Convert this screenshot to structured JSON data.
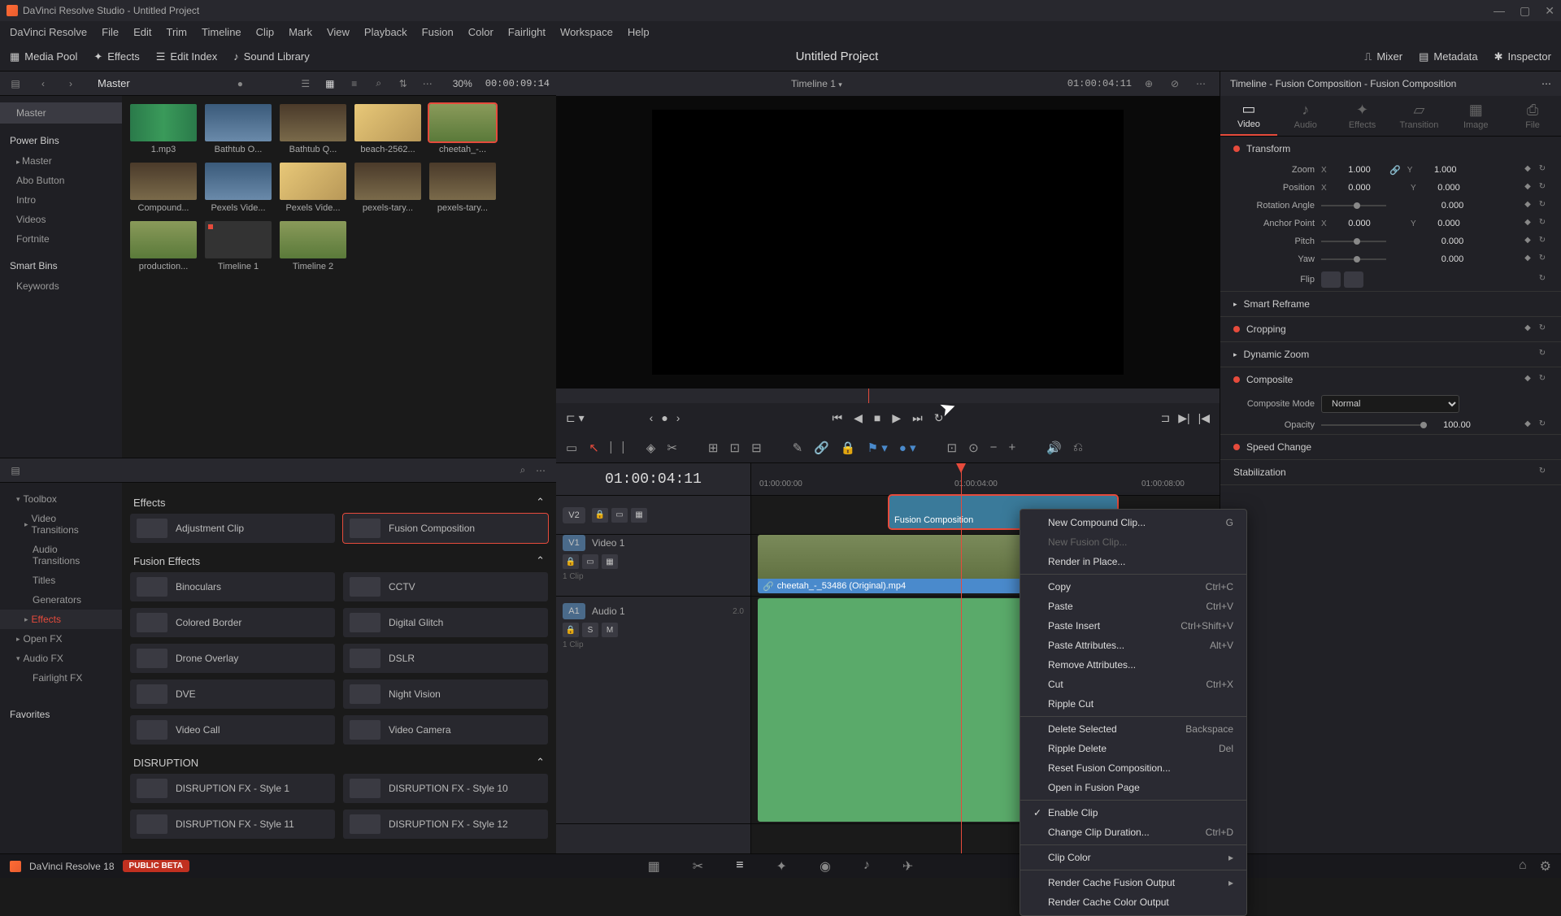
{
  "window": {
    "title": "DaVinci Resolve Studio - Untitled Project"
  },
  "menu": [
    "DaVinci Resolve",
    "File",
    "Edit",
    "Trim",
    "Timeline",
    "Clip",
    "Mark",
    "View",
    "Playback",
    "Fusion",
    "Color",
    "Fairlight",
    "Workspace",
    "Help"
  ],
  "toolbar": {
    "media_pool": "Media Pool",
    "effects": "Effects",
    "edit_index": "Edit Index",
    "sound_library": "Sound Library",
    "mixer": "Mixer",
    "metadata": "Metadata",
    "inspector": "Inspector",
    "project_title": "Untitled Project"
  },
  "media": {
    "master": "Master",
    "zoom": "30%",
    "tc": "00:00:09:14",
    "timeline_name": "Timeline 1",
    "playhead_tc": "01:00:04:11",
    "bins": {
      "section1": "Master",
      "section2": "Power Bins",
      "items2": [
        "Master",
        "Abo Button",
        "Intro",
        "Videos",
        "Fortnite"
      ],
      "section3": "Smart Bins",
      "items3": [
        "Keywords"
      ]
    },
    "clips": [
      "1.mp3",
      "Bathtub O...",
      "Bathtub Q...",
      "beach-2562...",
      "cheetah_-...",
      "Compound...",
      "Pexels Vide...",
      "Pexels Vide...",
      "pexels-tary...",
      "pexels-tary...",
      "production...",
      "Timeline 1",
      "Timeline 2"
    ]
  },
  "effects": {
    "sidebar": {
      "toolbox": "Toolbox",
      "items1": [
        "Video Transitions",
        "Audio Transitions",
        "Titles",
        "Generators",
        "Effects"
      ],
      "openfx": "Open FX",
      "audiofx": "Audio FX",
      "fairlight": "Fairlight FX",
      "favorites": "Favorites"
    },
    "groups": {
      "effects_label": "Effects",
      "fusion_label": "Fusion Effects",
      "disruption_label": "DISRUPTION"
    },
    "items": {
      "adjustment": "Adjustment Clip",
      "fusion_comp": "Fusion Composition",
      "binoculars": "Binoculars",
      "cctv": "CCTV",
      "colored_border": "Colored Border",
      "digital_glitch": "Digital Glitch",
      "drone": "Drone Overlay",
      "dslr": "DSLR",
      "dve": "DVE",
      "night": "Night Vision",
      "video_call": "Video Call",
      "video_camera": "Video Camera",
      "d1": "DISRUPTION FX - Style 1",
      "d10": "DISRUPTION FX - Style 10",
      "d11": "DISRUPTION FX - Style 11",
      "d12": "DISRUPTION FX - Style 12"
    }
  },
  "timeline": {
    "tc": "01:00:04:11",
    "ruler": [
      "01:00:00:00",
      "01:00:04:00",
      "01:00:08:00"
    ],
    "tracks": {
      "v2": "V2",
      "v1": "V1",
      "video1": "Video 1",
      "a1": "A1",
      "audio1": "Audio 1",
      "clip_count": "1 Clip",
      "audio_ch": "2.0"
    },
    "clips": {
      "fusion": "Fusion Composition",
      "video_name": "cheetah_-_53486 (Original).mp4"
    }
  },
  "context_menu": [
    {
      "label": "New Compound Clip...",
      "shortcut": "G"
    },
    {
      "label": "New Fusion Clip...",
      "disabled": true
    },
    {
      "label": "Render in Place..."
    },
    {
      "sep": true
    },
    {
      "label": "Copy",
      "shortcut": "Ctrl+C"
    },
    {
      "label": "Paste",
      "shortcut": "Ctrl+V"
    },
    {
      "label": "Paste Insert",
      "shortcut": "Ctrl+Shift+V"
    },
    {
      "label": "Paste Attributes...",
      "shortcut": "Alt+V"
    },
    {
      "label": "Remove Attributes..."
    },
    {
      "label": "Cut",
      "shortcut": "Ctrl+X"
    },
    {
      "label": "Ripple Cut"
    },
    {
      "sep": true
    },
    {
      "label": "Delete Selected",
      "shortcut": "Backspace"
    },
    {
      "label": "Ripple Delete",
      "shortcut": "Del"
    },
    {
      "label": "Reset Fusion Composition..."
    },
    {
      "label": "Open in Fusion Page"
    },
    {
      "sep": true
    },
    {
      "label": "Enable Clip",
      "checked": true
    },
    {
      "label": "Change Clip Duration...",
      "shortcut": "Ctrl+D"
    },
    {
      "sep": true
    },
    {
      "label": "Clip Color",
      "submenu": true
    },
    {
      "sep": true
    },
    {
      "label": "Render Cache Fusion Output",
      "submenu": true
    },
    {
      "label": "Render Cache Color Output"
    }
  ],
  "inspector": {
    "header": "Timeline - Fusion Composition - Fusion Composition",
    "tabs": [
      "Video",
      "Audio",
      "Effects",
      "Transition",
      "Image",
      "File"
    ],
    "transform": {
      "label": "Transform",
      "zoom": "Zoom",
      "zoom_x": "1.000",
      "zoom_y": "1.000",
      "position": "Position",
      "pos_x": "0.000",
      "pos_y": "0.000",
      "rotation": "Rotation Angle",
      "rot_val": "0.000",
      "anchor": "Anchor Point",
      "anc_x": "0.000",
      "anc_y": "0.000",
      "pitch": "Pitch",
      "pitch_val": "0.000",
      "yaw": "Yaw",
      "yaw_val": "0.000",
      "flip": "Flip"
    },
    "sections": {
      "smart_reframe": "Smart Reframe",
      "cropping": "Cropping",
      "dynamic_zoom": "Dynamic Zoom",
      "composite": "Composite",
      "composite_mode": "Composite Mode",
      "composite_mode_val": "Normal",
      "opacity": "Opacity",
      "opacity_val": "100.00",
      "speed": "Speed Change",
      "stabilization": "Stabilization"
    }
  },
  "bottom": {
    "app": "DaVinci Resolve 18",
    "beta": "PUBLIC BETA"
  }
}
